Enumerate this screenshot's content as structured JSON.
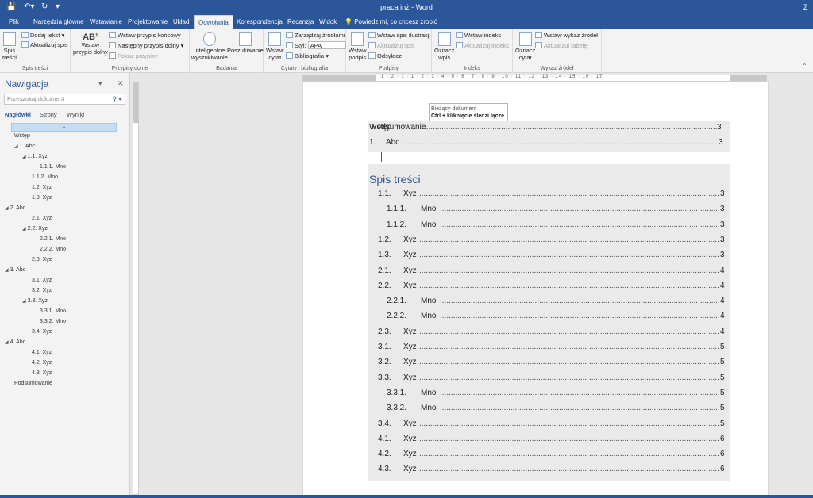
{
  "titlebar": {
    "title": "praca inż  -  Word",
    "user_initial": "Z"
  },
  "tabs": [
    {
      "label": "Plik"
    },
    {
      "label": "Narzędzia główne"
    },
    {
      "label": "Wstawianie"
    },
    {
      "label": "Projektowanie"
    },
    {
      "label": "Układ"
    },
    {
      "label": "Odwołania"
    },
    {
      "label": "Korespondencja"
    },
    {
      "label": "Recenzja"
    },
    {
      "label": "Widok"
    }
  ],
  "tell_me": "Powiedz mi, co chcesz zrobić",
  "ribbon": {
    "toc": {
      "btn": "Spis\ntreści",
      "add_text": "Dodaj tekst",
      "update": "Aktualizuj spis",
      "group": "Spis treści"
    },
    "footnotes": {
      "insert": "Wstaw\nprzypis dolny",
      "endnote": "Wstaw przypis końcowy",
      "next": "Następny przypis dolny",
      "show": "Pokaż przypisy",
      "group": "Przypisy dolne"
    },
    "research": {
      "smart": "Inteligentne\nwyszukiwanie",
      "research": "Poszukiwanie",
      "group": "Badania"
    },
    "citations": {
      "insert": "Wstaw\ncytat",
      "manage": "Zarządzaj źródłami",
      "style_label": "Styl:",
      "style_value": "APA",
      "biblio": "Bibliografia",
      "group": "Cytaty i bibliografia"
    },
    "captions": {
      "insert": "Wstaw\npodpis",
      "illus": "Wstaw spis ilustracji",
      "update": "Aktualizuj spis",
      "xref": "Odsyłacz",
      "group": "Podpisy"
    },
    "index": {
      "mark": "Oznacz\nwpis",
      "insert": "Wstaw indeks",
      "update": "Aktualizuj indeks",
      "group": "Indeks"
    },
    "toa": {
      "mark": "Oznacz\ncytat",
      "insert": "Wstaw wykaz źródeł",
      "update": "Aktualizuj tabelę",
      "group": "Wykaz źródeł"
    }
  },
  "nav": {
    "title": "Nawigacja",
    "search_placeholder": "Przeszukaj dokument",
    "tabs": [
      "Nagłówki",
      "Strony",
      "Wyniki"
    ],
    "items": [
      {
        "label": "Wstęp"
      },
      {
        "label": "1. Abc"
      },
      {
        "label": "1.1. Xyz"
      },
      {
        "label": "1.1.1. Mno"
      },
      {
        "label": "1.1.2. Mno"
      },
      {
        "label": "1.2. Xyz"
      },
      {
        "label": "1.3. Xyz"
      },
      {
        "label": "2. Abc"
      },
      {
        "label": "2.1. Xyz"
      },
      {
        "label": "2.2. Xyz"
      },
      {
        "label": "2.2.1. Mno"
      },
      {
        "label": "2.2.2. Mno"
      },
      {
        "label": "2.3. Xyz"
      },
      {
        "label": "3. Abc"
      },
      {
        "label": "3.1. Xyz"
      },
      {
        "label": "3.2. Xyz"
      },
      {
        "label": "3.3. Xyz"
      },
      {
        "label": "3.3.1. Mno"
      },
      {
        "label": "3.3.2. Mno"
      },
      {
        "label": "3.4. Xyz"
      },
      {
        "label": "4. Abc"
      },
      {
        "label": "4.1. Xyz"
      },
      {
        "label": "4.2. Xyz"
      },
      {
        "label": "4.3. Xyz"
      },
      {
        "label": "Podsumowanie"
      }
    ]
  },
  "tooltip": {
    "line1": "Bieżący dokument",
    "line2": "Ctrl + kliknięcie śledzi łącze"
  },
  "field": {
    "overlap_text": "Wstęp",
    "overlap_text2": "Podsumowanie",
    "overlap_page": "3",
    "line2_num": "1.",
    "line2_txt": "Abc",
    "line2_page": "3"
  },
  "toc": {
    "heading": "Spis treści",
    "rows": [
      {
        "num": "1.1.",
        "txt": "Xyz",
        "page": "3",
        "lvl": 2
      },
      {
        "num": "1.1.1.",
        "txt": "Mno",
        "page": "3",
        "lvl": 3
      },
      {
        "num": "1.1.2.",
        "txt": "Mno",
        "page": "3",
        "lvl": 3
      },
      {
        "num": "1.2.",
        "txt": "Xyz",
        "page": "3",
        "lvl": 2
      },
      {
        "num": "1.3.",
        "txt": "Xyz",
        "page": "3",
        "lvl": 2
      },
      {
        "num": "2.1.",
        "txt": "Xyz",
        "page": "4",
        "lvl": 2
      },
      {
        "num": "2.2.",
        "txt": "Xyz",
        "page": "4",
        "lvl": 2
      },
      {
        "num": "2.2.1.",
        "txt": "Mno",
        "page": "4",
        "lvl": 3
      },
      {
        "num": "2.2.2.",
        "txt": "Mno",
        "page": "4",
        "lvl": 3
      },
      {
        "num": "2.3.",
        "txt": "Xyz",
        "page": "4",
        "lvl": 2
      },
      {
        "num": "3.1.",
        "txt": "Xyz",
        "page": "5",
        "lvl": 2
      },
      {
        "num": "3.2.",
        "txt": "Xyz",
        "page": "5",
        "lvl": 2
      },
      {
        "num": "3.3.",
        "txt": "Xyz",
        "page": "5",
        "lvl": 2
      },
      {
        "num": "3.3.1.",
        "txt": "Mno",
        "page": "5",
        "lvl": 3
      },
      {
        "num": "3.3.2.",
        "txt": "Mno",
        "page": "5",
        "lvl": 3
      },
      {
        "num": "3.4.",
        "txt": "Xyz",
        "page": "5",
        "lvl": 2
      },
      {
        "num": "4.1.",
        "txt": "Xyz",
        "page": "6",
        "lvl": 2
      },
      {
        "num": "4.2.",
        "txt": "Xyz",
        "page": "6",
        "lvl": 2
      },
      {
        "num": "4.3.",
        "txt": "Xyz",
        "page": "6",
        "lvl": 2
      }
    ]
  },
  "ruler_numbers": "1 · 2 · 1 · 1 · 2 · 3 · 4 · 5 · 6 · 7 · 8 · 9 · 10 · 11 · 12 · 13 · 14 · 15 · 16 · 17"
}
